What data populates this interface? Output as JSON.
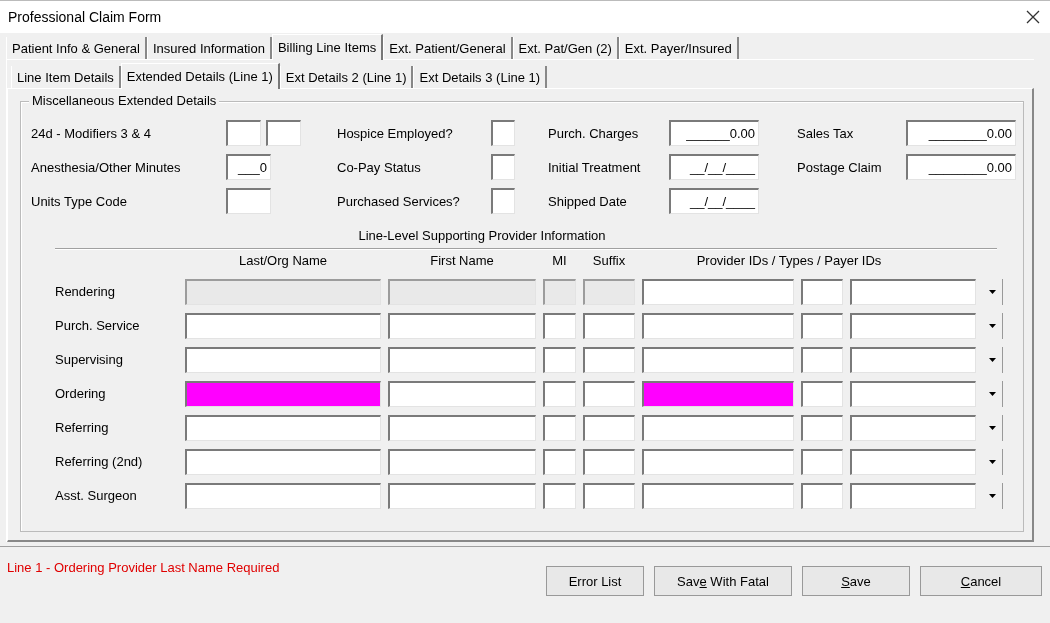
{
  "window": {
    "title": "Professional Claim Form"
  },
  "tabs": [
    {
      "label": "Patient Info & General",
      "selected": false
    },
    {
      "label": "Insured Information",
      "selected": false
    },
    {
      "label": "Billing Line Items",
      "selected": true
    },
    {
      "label": "Ext. Patient/General",
      "selected": false
    },
    {
      "label": "Ext. Pat/Gen (2)",
      "selected": false
    },
    {
      "label": "Ext. Payer/Insured",
      "selected": false
    }
  ],
  "subtabs": [
    {
      "label": "Line Item Details",
      "selected": false
    },
    {
      "label": "Extended Details (Line 1)",
      "selected": true
    },
    {
      "label": "Ext Details 2 (Line 1)",
      "selected": false
    },
    {
      "label": "Ext Details 3 (Line 1)",
      "selected": false
    }
  ],
  "group": {
    "title": "Miscellaneous Extended Details",
    "columns": [
      [
        {
          "label": "24d - Modifiers 3 & 4",
          "fields": [
            {
              "kind": "small"
            },
            {
              "kind": "small"
            }
          ]
        },
        {
          "label": "Anesthesia/Other Minutes",
          "fields": [
            {
              "kind": "medium",
              "value": "___0"
            }
          ]
        },
        {
          "label": "Units Type Code",
          "fields": [
            {
              "kind": "medium"
            }
          ]
        }
      ],
      [
        {
          "label": "Hospice Employed?",
          "fields": [
            {
              "kind": "tiny"
            }
          ]
        },
        {
          "label": "Co-Pay Status",
          "fields": [
            {
              "kind": "tiny"
            }
          ]
        },
        {
          "label": "Purchased Services?",
          "fields": [
            {
              "kind": "tiny"
            }
          ]
        }
      ],
      [
        {
          "label": "Purch. Charges",
          "fields": [
            {
              "kind": "wide",
              "value": "______0.00"
            }
          ]
        },
        {
          "label": "Initial Treatment",
          "fields": [
            {
              "kind": "wide",
              "value": "__/__/____"
            }
          ]
        },
        {
          "label": "Shipped Date",
          "fields": [
            {
              "kind": "wide",
              "value": "__/__/____"
            }
          ]
        }
      ],
      [
        {
          "label": "Sales Tax",
          "fields": [
            {
              "kind": "wider",
              "value": "________0.00"
            }
          ]
        },
        {
          "label": "Postage Claim",
          "fields": [
            {
              "kind": "wider",
              "value": "________0.00"
            }
          ]
        }
      ]
    ]
  },
  "providers": {
    "title": "Line-Level Supporting Provider Information",
    "columns": [
      "Last/Org Name",
      "First Name",
      "MI",
      "Suffix",
      "Provider IDs / Types / Payer IDs"
    ],
    "rows": [
      {
        "label": "Rendering",
        "disabled": true,
        "last_name_error": false,
        "provider_id_error": false
      },
      {
        "label": "Purch. Service",
        "disabled": false,
        "last_name_error": false,
        "provider_id_error": false
      },
      {
        "label": "Supervising",
        "disabled": false,
        "last_name_error": false,
        "provider_id_error": false
      },
      {
        "label": "Ordering",
        "disabled": false,
        "last_name_error": true,
        "provider_id_error": true
      },
      {
        "label": "Referring",
        "disabled": false,
        "last_name_error": false,
        "provider_id_error": false
      },
      {
        "label": "Referring (2nd)",
        "disabled": false,
        "last_name_error": false,
        "provider_id_error": false
      },
      {
        "label": "Asst. Surgeon",
        "disabled": false,
        "last_name_error": false,
        "provider_id_error": false
      }
    ]
  },
  "status_message": "Line 1 - Ordering Provider Last Name Required",
  "buttons": [
    {
      "pre": "Error List"
    },
    {
      "pre": "Sav",
      "key": "e",
      "post": " With Fatal"
    },
    {
      "key": "S",
      "post": "ave"
    },
    {
      "key": "C",
      "post": "ancel"
    }
  ]
}
